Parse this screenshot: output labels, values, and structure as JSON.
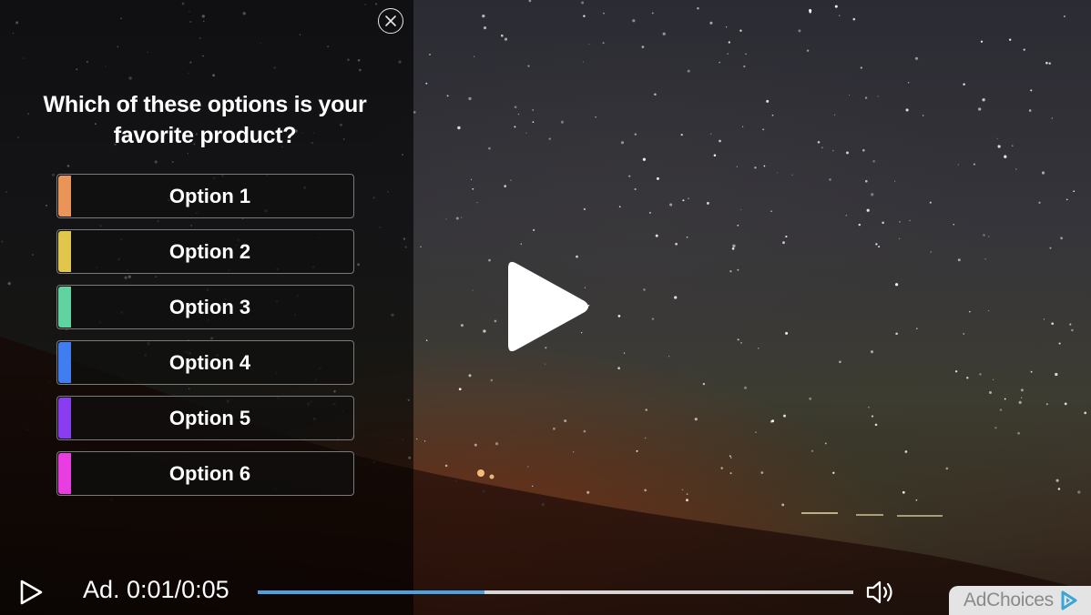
{
  "poll": {
    "question": "Which of these options is your favorite product?",
    "options": [
      {
        "label": "Option 1",
        "color": "#e9955a"
      },
      {
        "label": "Option 2",
        "color": "#e0c64a"
      },
      {
        "label": "Option 3",
        "color": "#5fd3a0"
      },
      {
        "label": "Option 4",
        "color": "#3f7df0"
      },
      {
        "label": "Option 5",
        "color": "#8a3cf0"
      },
      {
        "label": "Option 6",
        "color": "#e83de0"
      }
    ]
  },
  "controls": {
    "time_text": "Ad. 0:01/0:05",
    "progress_fraction": 0.38
  },
  "adchoices": {
    "label": "AdChoices",
    "brand_color": "#3aa6d8"
  },
  "icons": {
    "close": "close-icon",
    "big_play": "play-icon",
    "small_play": "play-icon",
    "volume": "volume-icon",
    "adchoices": "adchoices-icon"
  }
}
